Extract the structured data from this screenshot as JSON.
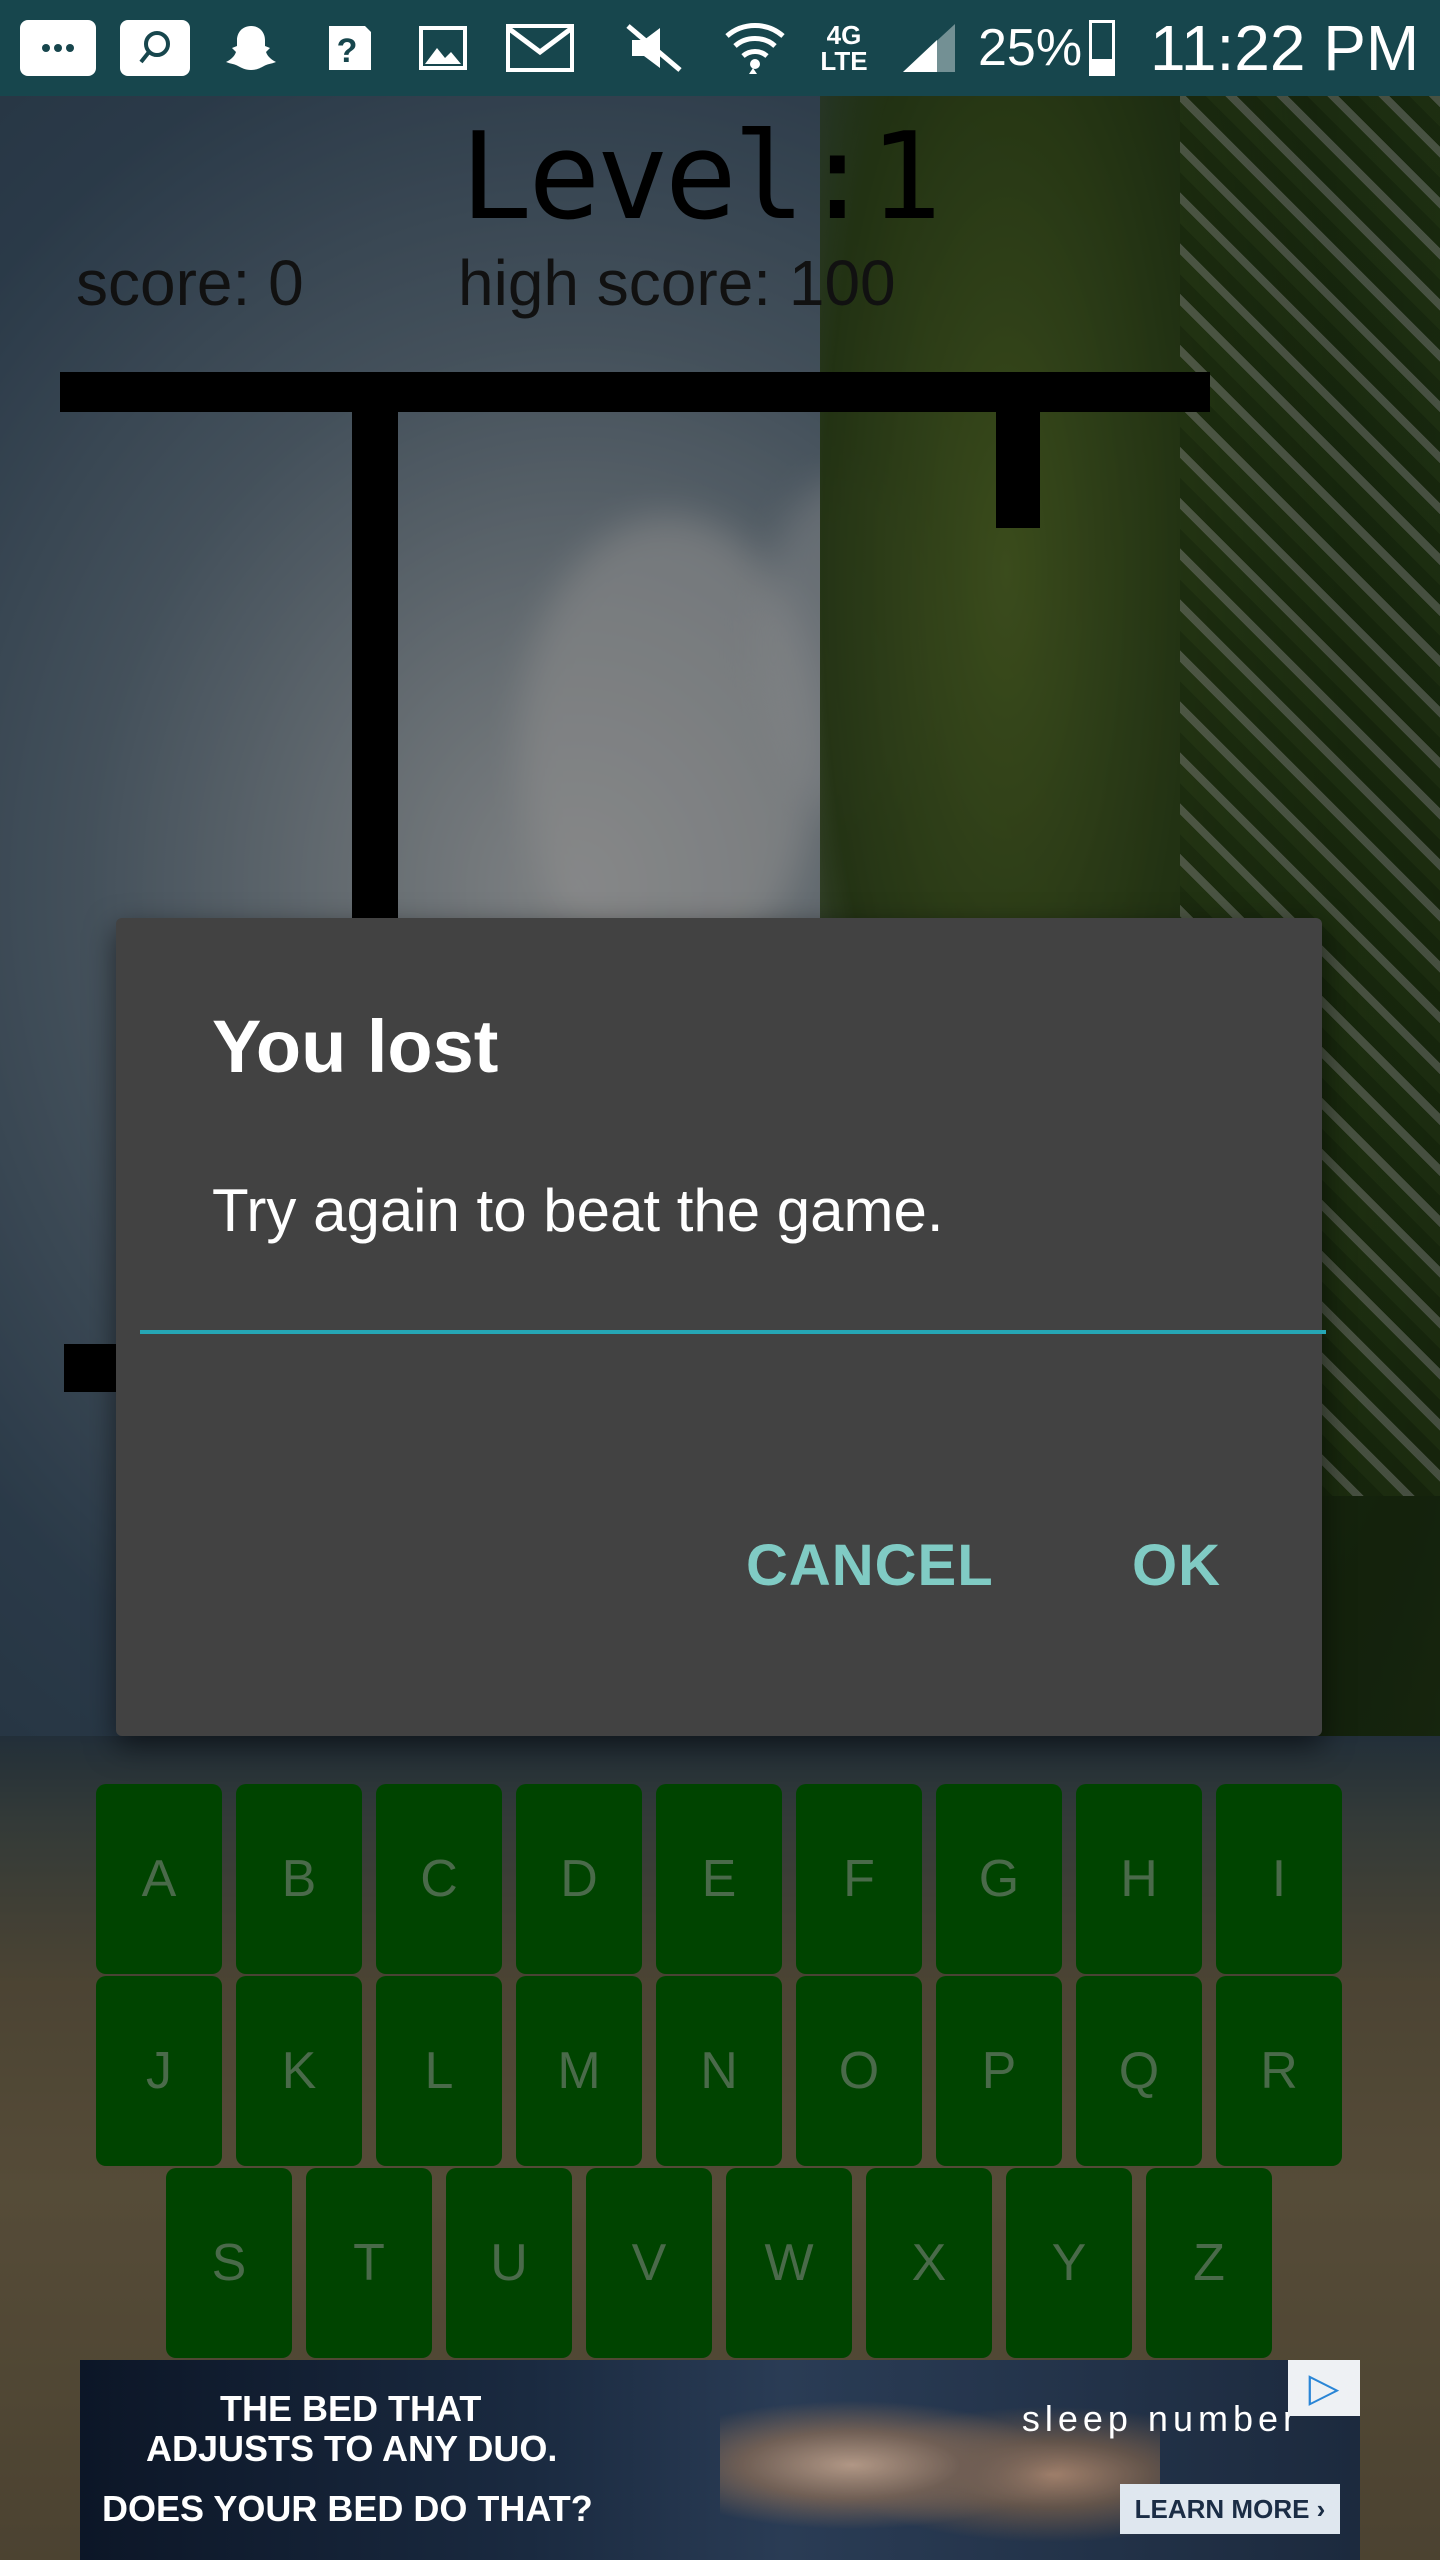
{
  "status_bar": {
    "battery": "25%",
    "time": "11:22 PM",
    "network": "4G LTE",
    "icons": [
      "messages-icon",
      "search-app-icon",
      "snapchat-icon",
      "help-icon",
      "gallery-icon",
      "gmail-icon",
      "mute-icon",
      "wifi-icon",
      "lte-icon",
      "signal-icon",
      "battery-icon"
    ]
  },
  "game": {
    "level_label": "Level:1",
    "score_label": "score: 0",
    "high_score_label": "high score: 100"
  },
  "dialog": {
    "title": "You lost",
    "message": "Try again to beat the game.",
    "input_value": "",
    "cancel_label": "CANCEL",
    "ok_label": "OK",
    "accent_color": "#26a6b5",
    "button_color": "#80cbc4"
  },
  "keyboard": {
    "key_color": "#004400",
    "row1": [
      "A",
      "B",
      "C",
      "D",
      "E",
      "F",
      "G",
      "H",
      "I"
    ],
    "row2": [
      "J",
      "K",
      "L",
      "M",
      "N",
      "O",
      "P",
      "Q",
      "R"
    ],
    "row3": [
      "S",
      "T",
      "U",
      "V",
      "W",
      "X",
      "Y",
      "Z"
    ]
  },
  "ad": {
    "line1": "THE BED THAT",
    "line2": "ADJUSTS TO ANY DUO.",
    "line3": "DOES YOUR BED DO THAT?",
    "brand": "sleep number",
    "cta": "LEARN MORE ›"
  }
}
